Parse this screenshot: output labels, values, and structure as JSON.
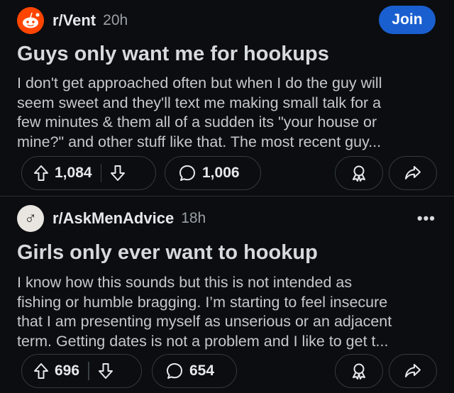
{
  "posts": [
    {
      "subreddit": "r/Vent",
      "time": "20h",
      "join_label": "Join",
      "title": "Guys only want me for hookups",
      "body_lines": [
        "I don't get approached often but when I do the guy will",
        "seem sweet and they'll text me making small talk for a",
        "few minutes & them all of a sudden its \"your house or",
        "mine?\" and other stuff like that. The most recent guy..."
      ],
      "upvotes": "1,084",
      "comments": "1,006",
      "avatar_icon": "reddit-snoo-icon"
    },
    {
      "subreddit": "r/AskMenAdvice",
      "time": "18h",
      "more_label": "•••",
      "title": "Girls only ever want to hookup",
      "body_lines": [
        "I know how this sounds but this is not intended as",
        "fishing or humble bragging. I’m starting to feel insecure",
        "that I am presenting myself as unserious or an adjacent",
        "term. Getting dates is not a problem and I like to get t..."
      ],
      "upvotes": "696",
      "comments": "654",
      "avatar_symbol": "♂"
    }
  ],
  "colors": {
    "background": "#0b0d10",
    "join_button": "#1a5fd0",
    "vent_avatar": "#ff4500"
  }
}
